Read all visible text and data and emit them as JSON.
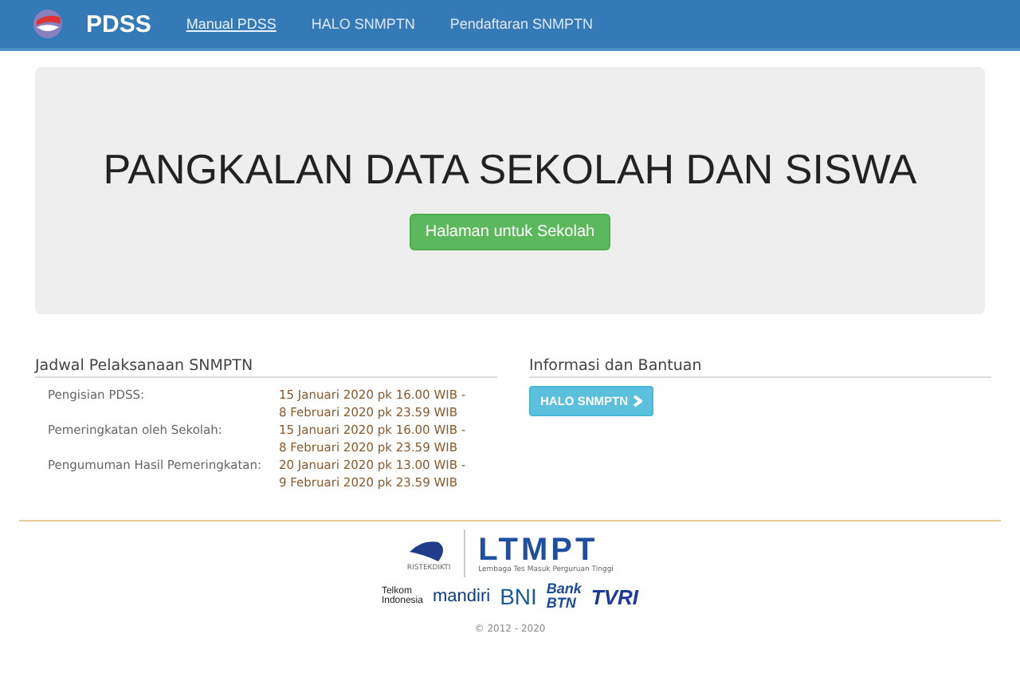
{
  "navbar": {
    "brand": "PDSS",
    "links": [
      {
        "label": "Manual PDSS",
        "selected": true
      },
      {
        "label": "HALO SNMPTN",
        "selected": false
      },
      {
        "label": "Pendaftaran SNMPTN",
        "selected": false
      }
    ]
  },
  "hero": {
    "title": "PANGKALAN DATA SEKOLAH DAN SISWA",
    "button": "Halaman untuk Sekolah"
  },
  "schedule": {
    "heading": "Jadwal Pelaksanaan SNMPTN",
    "rows": [
      {
        "label": "Pengisian PDSS:",
        "lines": [
          "15 Januari 2020 pk 16.00 WIB -",
          "8 Februari 2020 pk 23.59 WIB"
        ]
      },
      {
        "label": "Pemeringkatan oleh Sekolah:",
        "lines": [
          "15 Januari 2020 pk 16.00 WIB -",
          "8 Februari 2020 pk 23.59 WIB"
        ]
      },
      {
        "label": "Pengumuman Hasil Pemeringkatan:",
        "lines": [
          "20 Januari 2020 pk 13.00 WIB -",
          "9 Februari 2020 pk 23.59 WIB"
        ]
      }
    ]
  },
  "info": {
    "heading": "Informasi dan Bantuan",
    "button": "HALO SNMPTN"
  },
  "footer": {
    "ministry": "RISTEKDIKTI",
    "ltmpt": "LTMPT",
    "ltmpt_sub": "Lembaga Tes Masuk Perguruan Tinggi",
    "sponsors": [
      {
        "kind": "telkom",
        "lines": [
          "Telkom",
          "Indonesia"
        ]
      },
      {
        "kind": "mandiri",
        "lines": [
          "mandiri"
        ]
      },
      {
        "kind": "bni",
        "lines": [
          "BNI"
        ]
      },
      {
        "kind": "btn",
        "lines": [
          "Bank",
          "BTN"
        ]
      },
      {
        "kind": "tvri",
        "lines": [
          "TVRI"
        ]
      }
    ],
    "copyright": "© 2012 - 2020"
  }
}
